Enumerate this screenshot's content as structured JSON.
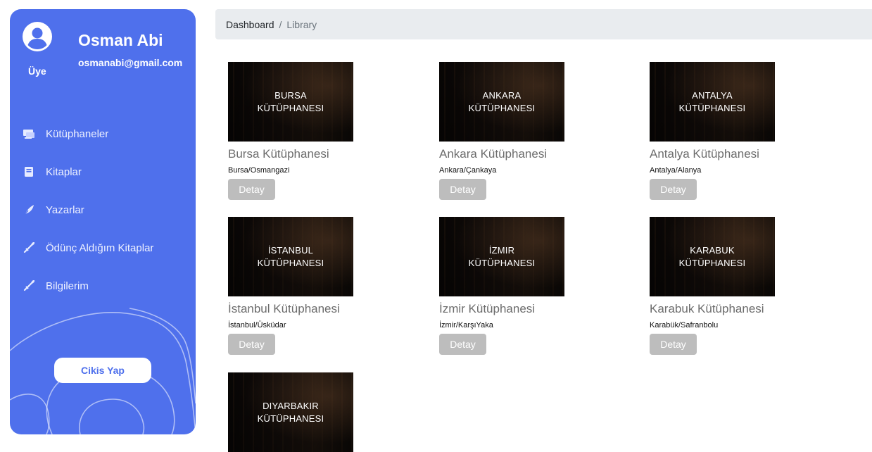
{
  "user": {
    "name": "Osman Abi",
    "email": "osmanabi@gmail.com",
    "role": "Üye"
  },
  "nav": [
    {
      "label": "Kütüphaneler",
      "icon": "library-icon"
    },
    {
      "label": "Kitaplar",
      "icon": "book-icon"
    },
    {
      "label": "Yazarlar",
      "icon": "feather-icon"
    },
    {
      "label": "Ödünç Aldığım Kitaplar",
      "icon": "quill-icon"
    },
    {
      "label": "Bilgilerim",
      "icon": "quill-icon"
    }
  ],
  "logout_label": "Cikis Yap",
  "breadcrumb": {
    "root": "Dashboard",
    "separator": "/",
    "current": "Library"
  },
  "libraries": [
    {
      "image_text": "BURSA\nKÜTÜPHANESI",
      "title": "Bursa Kütüphanesi",
      "location": "Bursa/Osmangazi",
      "button": "Detay"
    },
    {
      "image_text": "ANKARA\nKÜTÜPHANESI",
      "title": "Ankara Kütüphanesi",
      "location": "Ankara/Çankaya",
      "button": "Detay"
    },
    {
      "image_text": "ANTALYA\nKÜTÜPHANESI",
      "title": "Antalya Kütüphanesi",
      "location": "Antalya/Alanya",
      "button": "Detay"
    },
    {
      "image_text": "İSTANBUL\nKÜTÜPHANESI",
      "title": "İstanbul Kütüphanesi",
      "location": "İstanbul/Üsküdar",
      "button": "Detay"
    },
    {
      "image_text": "İZMIR\nKÜTÜPHANESI",
      "title": "İzmir Kütüphanesi",
      "location": "İzmir/KarşıYaka",
      "button": "Detay"
    },
    {
      "image_text": "KARABUK\nKÜTÜPHANESI",
      "title": "Karabuk Kütüphanesi",
      "location": "Karabük/Safranbolu",
      "button": "Detay"
    },
    {
      "image_text": "DIYARBAKIR\nKÜTÜPHANESI",
      "title": "",
      "location": "",
      "button": ""
    }
  ],
  "colors": {
    "sidebar": "#4f70ec",
    "breadcrumb_bg": "#e9ecef",
    "button_disabled": "#bdbdbd"
  }
}
